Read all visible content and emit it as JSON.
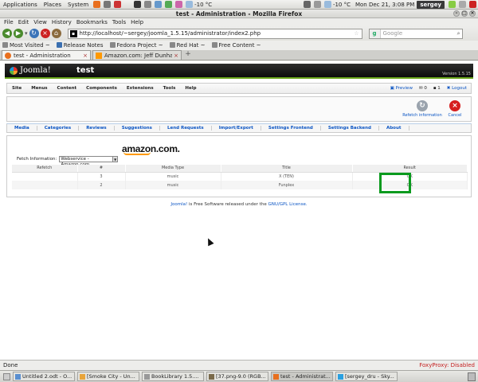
{
  "panel": {
    "menus": [
      "Applications",
      "Places",
      "System"
    ],
    "weather_left": "-10 °C",
    "weather_right": "-10 °C",
    "clock": "Mon Dec 21,  3:08 PM",
    "user": "sergey"
  },
  "window": {
    "title": "test - Administration - Mozilla Firefox"
  },
  "menubar": [
    "File",
    "Edit",
    "View",
    "History",
    "Bookmarks",
    "Tools",
    "Help"
  ],
  "navbar": {
    "url": "http://localhost/~sergey/joomla_1.5.15/administrator/index2.php",
    "search_placeholder": "Google"
  },
  "bookmarks": [
    "Most Visited ~",
    "Release Notes",
    "Fedora Project ~",
    "Red Hat ~",
    "Free Content ~"
  ],
  "tabs": [
    {
      "label": "test - Administration"
    },
    {
      "label": "Amazon.com: Jeff Dunham - ..."
    }
  ],
  "joomla": {
    "logo": "Joomla!",
    "site": "test",
    "version": "Version 1.5.15",
    "menu": [
      "Site",
      "Menus",
      "Content",
      "Components",
      "Extensions",
      "Tools",
      "Help"
    ],
    "preview": "Preview",
    "msg_count": "0",
    "users_count": "1",
    "logout": "Logout",
    "toolbar": {
      "refetch": "Refetch information",
      "cancel": "Cancel"
    },
    "submenu": [
      "Media",
      "Categories",
      "Reviews",
      "Suggestions",
      "Lend Requests",
      "Import/Export",
      "Settings Frontend",
      "Settings Backend",
      "About"
    ],
    "amazon_logo": "amazon.com.",
    "fetch_label": "Fetch Information:",
    "fetch_value": "Webservice - Amazon.com",
    "table": {
      "headers": [
        "Refetch",
        "#",
        "Media Type",
        "Title",
        "Result"
      ],
      "rows": [
        [
          "",
          "3",
          "music",
          "X (TEN)",
          "OK"
        ],
        [
          "",
          "2",
          "music",
          "Funplex",
          "OK"
        ]
      ]
    },
    "footer": {
      "a": "Joomla!",
      "b": " is Free Software released under the ",
      "c": "GNU/GPL License."
    }
  },
  "status": {
    "text": "Done",
    "proxy": "FoxyProxy: Disabled"
  },
  "taskbar": [
    "Untitled 2.odt - O...",
    "[Smoke City - Un...",
    "BookLibrary 1.5....",
    "[37.png-9.0 (RGB...",
    "test - Administrat...",
    "[sergey_dru - Sky..."
  ]
}
